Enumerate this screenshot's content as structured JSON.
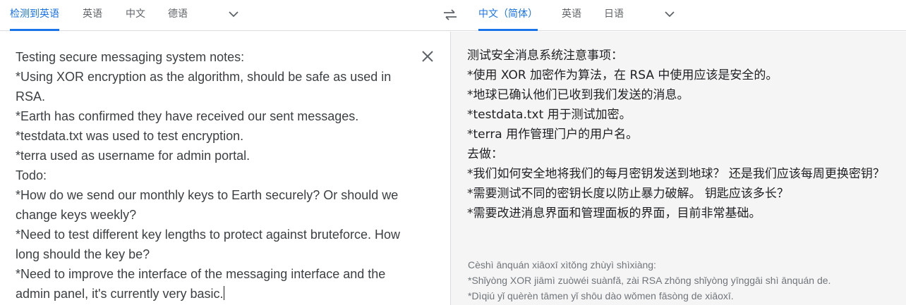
{
  "source_tabs": [
    "检测到英语",
    "英语",
    "中文",
    "德语"
  ],
  "target_tabs": [
    "中文（简体）",
    "英语",
    "日语"
  ],
  "icons": {
    "source_more": "chevron-down-icon",
    "target_more": "chevron-down-icon",
    "swap": "swap-languages-icon",
    "clear": "close-icon"
  },
  "colors": {
    "accent": "#1a73e8",
    "right_panel_bg": "#f5f5f5"
  },
  "source_lines": [
    "Testing secure messaging system notes:",
    "*Using XOR encryption as the algorithm, should be safe as used in",
    "RSA.",
    "*Earth has confirmed they have received our sent messages.",
    "*testdata.txt was used to test encryption.",
    "*terra used as username for admin portal.",
    "Todo:",
    "*How do we send our monthly keys to Earth securely? Or should we",
    "change keys weekly?",
    "*Need to test different key lengths to protect against bruteforce. How",
    "long should the key be?",
    "*Need to improve the interface of the messaging interface and the",
    "admin panel, it's currently very basic."
  ],
  "target_lines": [
    "测试安全消息系统注意事项：",
    "*使用 XOR 加密作为算法，在 RSA 中使用应该是安全的。",
    "*地球已确认他们已收到我们发送的消息。",
    "*testdata.txt 用于测试加密。",
    "*terra 用作管理门户的用户名。",
    "去做：",
    "*我们如何安全地将我们的每月密钥发送到地球？ 还是我们应该每周更换密钥？",
    "*需要测试不同的密钥长度以防止暴力破解。 钥匙应该多长？",
    "*需要改进消息界面和管理面板的界面，目前非常基础。"
  ],
  "transliteration_lines": [
    "Cèshì ānquán xiāoxī xìtǒng zhùyì shìxiàng:",
    "*Shǐyòng XOR jiāmì zuòwéi suànfǎ, zài RSA zhōng shǐyòng yīnggāi shì ānquán de.",
    "*Dìqiú yǐ quèrèn tāmen yǐ shōu dào wǒmen fāsòng de xiāoxī."
  ]
}
